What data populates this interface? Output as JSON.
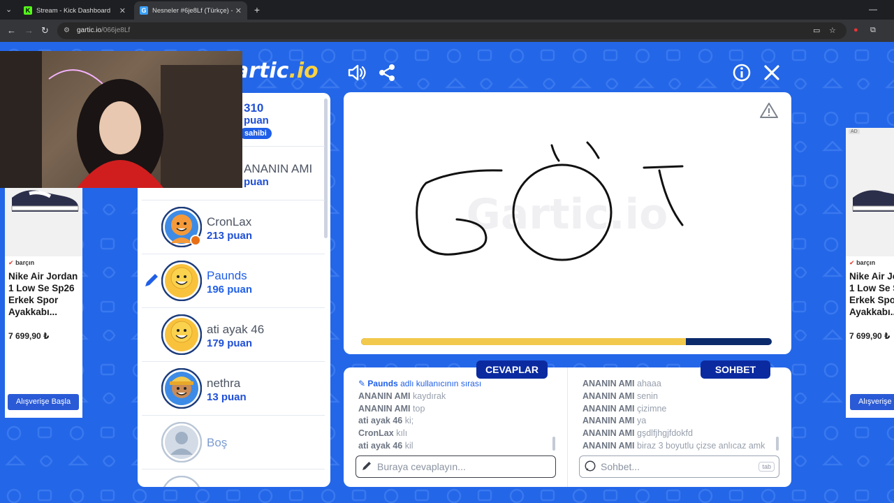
{
  "browser": {
    "tabs": [
      {
        "title": "Stream - Kick Dashboard",
        "icon": "kick-icon"
      },
      {
        "title": "Nesneler #6je8Lf (Türkçe) - Gartic",
        "icon": "gartic-icon"
      }
    ],
    "url_host": "gartic.io",
    "url_path": "/066je8Lf"
  },
  "game": {
    "logo_main": "artic",
    "logo_io": ".io",
    "drawing_text": "GÖT",
    "progress": 0.79
  },
  "players": [
    {
      "name": "",
      "points": "310",
      "points_label": "puan",
      "badge": "sahibi",
      "partial": true
    },
    {
      "name": "ANANIN AMI",
      "points_label": "puan",
      "partial": true
    },
    {
      "name": "CronLax",
      "points": "213 puan",
      "avatar": "orange"
    },
    {
      "name": "Paunds",
      "points": "196 puan",
      "avatar": "yellow",
      "drawing": true
    },
    {
      "name": "ati ayak 46",
      "points": "179 puan",
      "avatar": "yellow"
    },
    {
      "name": "nethra",
      "points": "13 puan",
      "avatar": "cap"
    },
    {
      "name": "Boş",
      "empty": true
    }
  ],
  "answers": {
    "title": "CEVAPLAR",
    "system_user": "Paunds",
    "system_text": "adlı kullanıcının sırası",
    "messages": [
      {
        "user": "ANANIN AMI",
        "text": "kaydırak"
      },
      {
        "user": "ANANIN AMI",
        "text": "top"
      },
      {
        "user": "ati ayak 46",
        "text": "ki;"
      },
      {
        "user": "CronLax",
        "text": "kılı"
      },
      {
        "user": "ati ayak 46",
        "text": "kil"
      }
    ],
    "placeholder": "Buraya cevaplayın..."
  },
  "chat": {
    "title": "SOHBET",
    "messages": [
      {
        "user": "ANANIN AMI",
        "text": "ahaaa"
      },
      {
        "user": "ANANIN AMI",
        "text": "senin"
      },
      {
        "user": "ANANIN AMI",
        "text": "çizimne"
      },
      {
        "user": "ANANIN AMI",
        "text": "ya"
      },
      {
        "user": "ANANIN AMI",
        "text": "gşdlfjhgjfdokfd"
      },
      {
        "user": "ANANIN AMI",
        "text": "biraz 3 boyutlu çizse anlıcaz amk"
      }
    ],
    "placeholder": "Sohbet...",
    "tab_hint": "tab"
  },
  "ads": {
    "brand": "barçın",
    "title": "Nike Air Jordan 1 Low Se Sp26 Erkek Spor Ayakkabı...",
    "price": "7 699,90 ₺",
    "button": "Alışverişe Başla",
    "ad_tag": "AD"
  },
  "colors": {
    "background": "#2366e8",
    "accent": "#1f5fe8",
    "section_title": "#0b2aa0",
    "progress_fill": "#f2c94c",
    "progress_track": "#0b2a6b"
  }
}
